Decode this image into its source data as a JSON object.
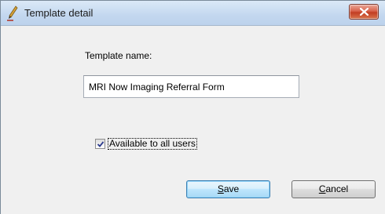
{
  "window": {
    "title": "Template detail",
    "title_icon": "pen-icon"
  },
  "form": {
    "name_label": "Template name:",
    "name_value": "MRI Now Imaging Referral Form",
    "available_label": "Available to all users",
    "available_checked": true
  },
  "buttons": {
    "save_mnemonic": "S",
    "save_rest": "ave",
    "cancel_mnemonic": "C",
    "cancel_rest": "ancel"
  },
  "colors": {
    "titlebar": "#c3d7ef",
    "close_button": "#c23d22",
    "default_button_border": "#3c7fb1"
  }
}
